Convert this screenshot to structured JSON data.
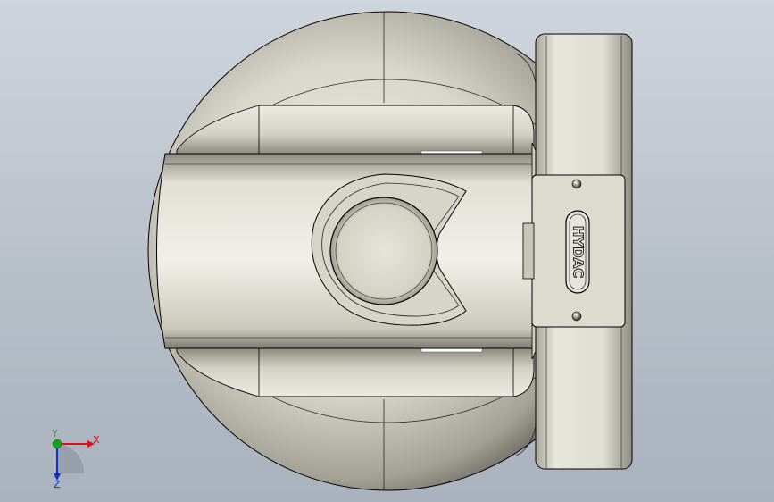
{
  "model": {
    "brand_text": "HYDAC"
  },
  "triad": {
    "x_label": "X",
    "y_label": "Y",
    "z_label": "Z"
  },
  "colors": {
    "background_top": "#cfd5dd",
    "background_bottom": "#a9b2bd",
    "metal_light": "#f3f2ea",
    "metal_mid": "#cfcdbf",
    "metal_dark": "#6f6d63",
    "edge": "#000000",
    "axis_x": "#e01010",
    "axis_y": "#18a020",
    "axis_z": "#1030c0"
  }
}
